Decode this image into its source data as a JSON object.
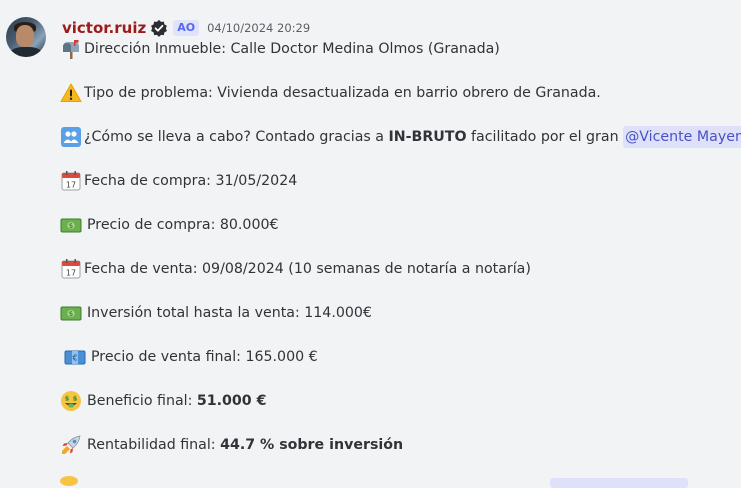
{
  "author": {
    "username": "victor.ruiz",
    "tag": "AO",
    "timestamp": "04/10/2024 20:29"
  },
  "lines": {
    "direccion": "Dirección Inmueble: Calle Doctor Medina Olmos (Granada)",
    "tipo": "Tipo de problema: Vivienda desactualizada en barrio obrero de Granada.",
    "como_pre": "¿Cómo se lleva a cabo? Contado gracias a ",
    "como_bold": "IN-BRUTO",
    "como_post": " facilitado por el gran ",
    "como_mention": "@Vicente Mayenco",
    "fecha_compra": "Fecha de compra: 31/05/2024",
    "precio_compra": "Precio de compra: 80.000€",
    "fecha_venta": "Fecha de venta: 09/08/2024 (10 semanas de notaría a notaría)",
    "inversion": "Inversión total hasta la venta: 114.000€",
    "precio_venta": "Precio de venta final: 165.000 €",
    "beneficio_label": "Beneficio final: ",
    "beneficio_value": "51.000 €",
    "rentabilidad_label": "Rentabilidad final: ",
    "rentabilidad_value": "44.7 % sobre inversión"
  },
  "icons": {
    "mailbox": "mailbox-icon",
    "warning": "warning-icon",
    "people": "people-icon",
    "calendar": "calendar-icon",
    "money": "money-icon",
    "money_euro": "euro-banknote-icon",
    "money_face": "money-mouth-face-icon",
    "rocket": "rocket-icon"
  },
  "colors": {
    "background": "#f2f3f5",
    "username": "#9c1b1b",
    "mention_bg": "#dfe1fa",
    "mention_text": "#4752c4",
    "tag_bg": "#dfe3fb",
    "tag_text": "#5865f2"
  }
}
